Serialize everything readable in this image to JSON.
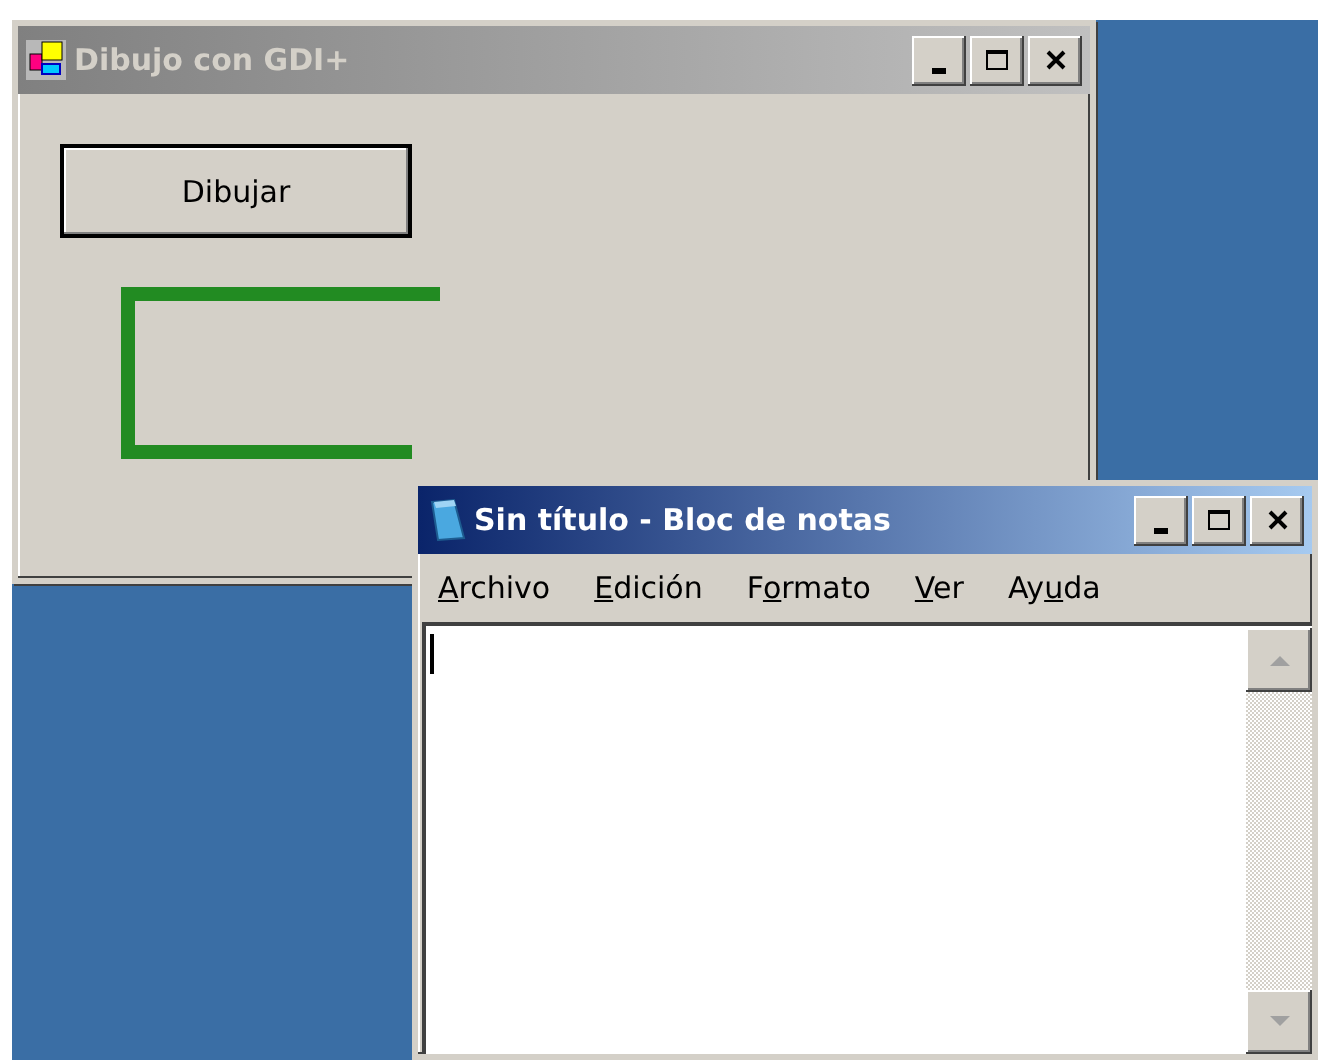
{
  "windows": [
    {
      "title": "Dibujo con GDI+",
      "active": false,
      "kind": "form",
      "button": "Dibujar"
    },
    {
      "title": "Sin título - Bloc de notas",
      "active": true,
      "kind": "notepad",
      "menu": [
        {
          "access_key": "A",
          "after": "rchivo"
        },
        {
          "access_key": "E",
          "after": "dición"
        },
        {
          "before": "F",
          "access_key": "o",
          "after": "rmato"
        },
        {
          "access_key": "V",
          "after": "er"
        },
        {
          "before": "Ay",
          "access_key": "u",
          "after": "da"
        }
      ]
    }
  ]
}
